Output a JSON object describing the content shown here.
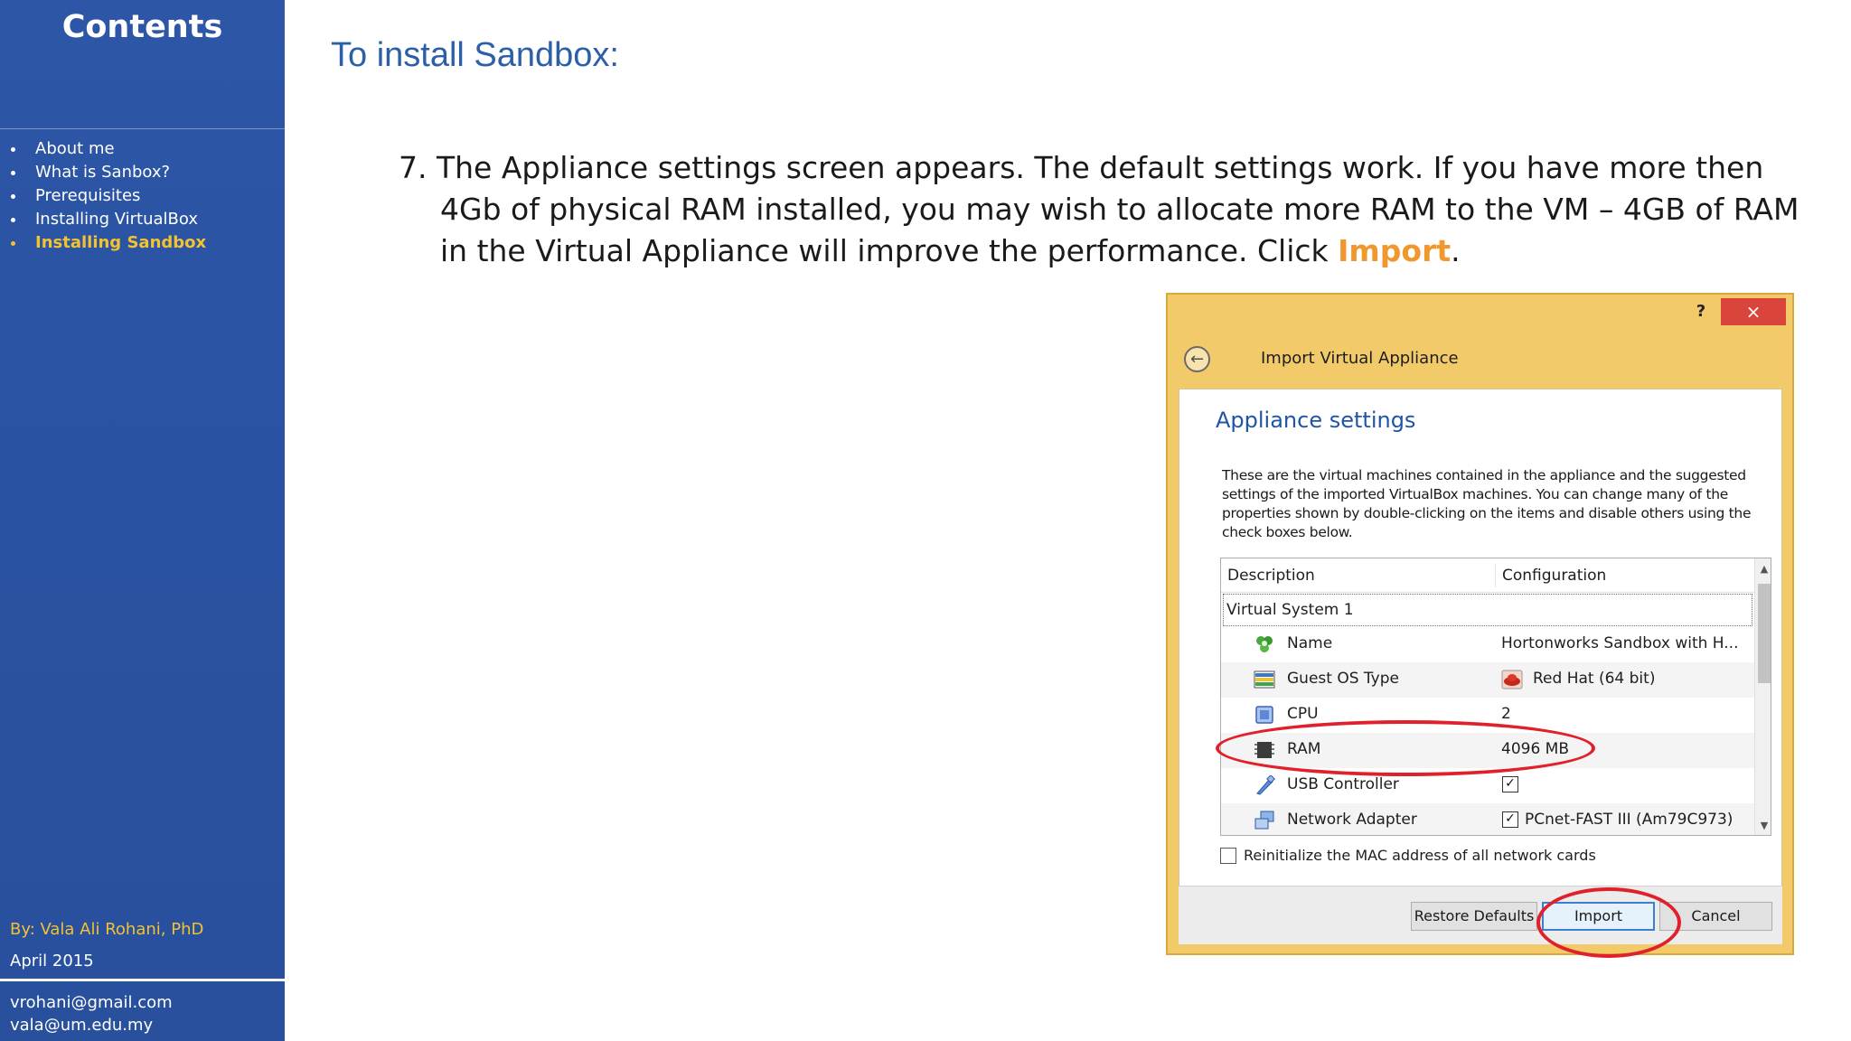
{
  "sidebar": {
    "title": "Contents",
    "items": [
      {
        "label": "About me"
      },
      {
        "label": "What is Sanbox?"
      },
      {
        "label": "Prerequisites"
      },
      {
        "label": "Installing VirtualBox"
      },
      {
        "label": "Installing Sandbox"
      }
    ],
    "active_index": 4,
    "author": "By: Vala Ali Rohani, PhD",
    "date": "April 2015",
    "emails": [
      "vrohani@gmail.com",
      "vala@um.edu.my"
    ]
  },
  "main": {
    "heading": "To install Sandbox:",
    "step_text": "7. The Appliance settings screen appears. The default settings work. If you have more then 4Gb of physical RAM installed, you may wish to allocate more RAM to the VM – 4GB of RAM in the Virtual Appliance will improve the performance.  Click ",
    "step_highlight": "Import",
    "step_end": "."
  },
  "dialog": {
    "help_label": "?",
    "close_label": "×",
    "back_glyph": "←",
    "title": "Import Virtual Appliance",
    "section_title": "Appliance settings",
    "description": "These are the virtual machines contained in the appliance and the suggested settings of the imported VirtualBox machines. You can change many of the properties shown by double-clicking on the items and disable others using the check boxes below.",
    "columns": [
      "Description",
      "Configuration"
    ],
    "system_label": "Virtual System 1",
    "rows": [
      {
        "label": "Name",
        "value": "Hortonworks Sandbox with H...",
        "icon": "name-icon"
      },
      {
        "label": "Guest OS Type",
        "value": "Red Hat (64 bit)",
        "icon": "guest-os-icon"
      },
      {
        "label": "CPU",
        "value": "2",
        "icon": "cpu-icon"
      },
      {
        "label": "RAM",
        "value": "4096 MB",
        "icon": "ram-icon"
      },
      {
        "label": "USB Controller",
        "value": "",
        "checked": true,
        "icon": "usb-icon"
      },
      {
        "label": "Network Adapter",
        "value": "PCnet-FAST III (Am79C973)",
        "checked": true,
        "icon": "network-adapter-icon"
      }
    ],
    "mac_label": "Reinitialize the MAC address of all network cards",
    "buttons": {
      "restore": "Restore Defaults",
      "import": "Import",
      "cancel": "Cancel"
    }
  },
  "colors": {
    "sidebar_bg": "#2a52a2",
    "accent_yellow": "#f2c230",
    "heading_blue": "#2b5fa8",
    "highlight_orange": "#f0982d",
    "dialog_frame": "#f3ca69",
    "annotation_red": "#e0202a"
  }
}
